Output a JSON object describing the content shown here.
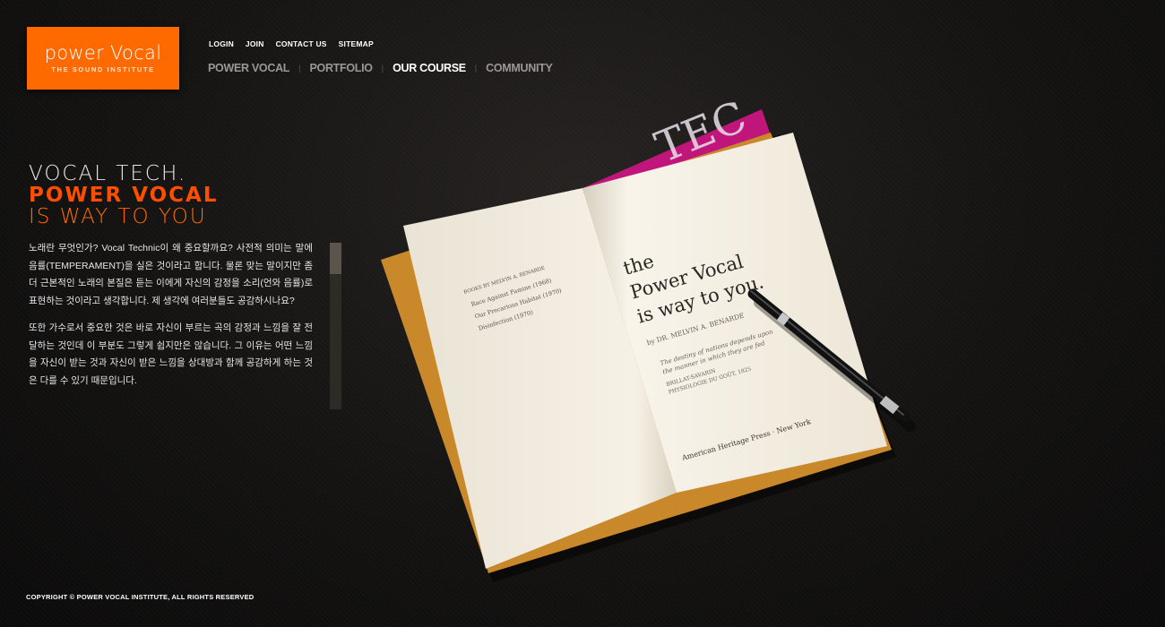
{
  "logo": {
    "main": "power Vocal",
    "sub": "THE SOUND INSTITUTE"
  },
  "util_nav": [
    "LOGIN",
    "JOIN",
    "CONTACT US",
    "SITEMAP"
  ],
  "main_nav": [
    {
      "label": "POWER VOCAL",
      "active": false
    },
    {
      "label": "PORTFOLIO",
      "active": false
    },
    {
      "label": "OUR COURSE",
      "active": true
    },
    {
      "label": "COMMUNITY",
      "active": false
    }
  ],
  "hero": {
    "line1": "VOCAL TECH.",
    "line2": "POWER VOCAL",
    "line3": "IS WAY TO YOU"
  },
  "description": {
    "p1": "노래란 무엇인가? Vocal Technic이 왜 중요할까요? 사전적 의미는 말에 음률(TEMPERAMENT)을 실은 것이라고 합니다. 물론 맞는 말이지만 좀 더 근본적인 노래의 본질은 듣는 이에게 자신의 감정을 소리(언와 음률)로 표현하는 것이라고 생각합니다. 제 생각에 여러분들도 공감하시나요?",
    "p2": "또한 가수로서 중요한 것은 바로 자신이 부르는 곡의 감정과 느낌을 잘 전달하는 것인데 이 부분도 그렇게 쉽지만은 않습니다. 그 이유는 어떤 느낌을 자신이 받는 것과 자신이 받은 느낌을 상대방과 함께 공감하게 하는 것은 다를 수 있기 때문입니다."
  },
  "book": {
    "left_heading": "BOOKS BY MELVIN A. BENARDE",
    "left_list": [
      "Race Against Famine (1968)",
      "Our Precarious Habitat (1970)",
      "Disinfection (1970)"
    ],
    "title_l1": "the",
    "title_l2": "Power Vocal",
    "title_l3": "is way to you.",
    "author": "by DR. MELVIN A. BENARDE",
    "quote_l1": "The destiny of nations depends upon",
    "quote_l2": "the manner in which they are fed",
    "quote_author": "BRILLAT-SAVARIN",
    "quote_source": "PHYSIOLOGIE DU GOÛT, 1825",
    "publisher": "American Heritage Press · New York",
    "magazine": "TEC"
  },
  "footer": "COPYRIGHT © POWER VOCAL INSTITUTE, ALL RIGHTS RESERVED",
  "colors": {
    "accent": "#ff6a00",
    "accent_bold": "#ff4e00",
    "background": "#141312"
  }
}
